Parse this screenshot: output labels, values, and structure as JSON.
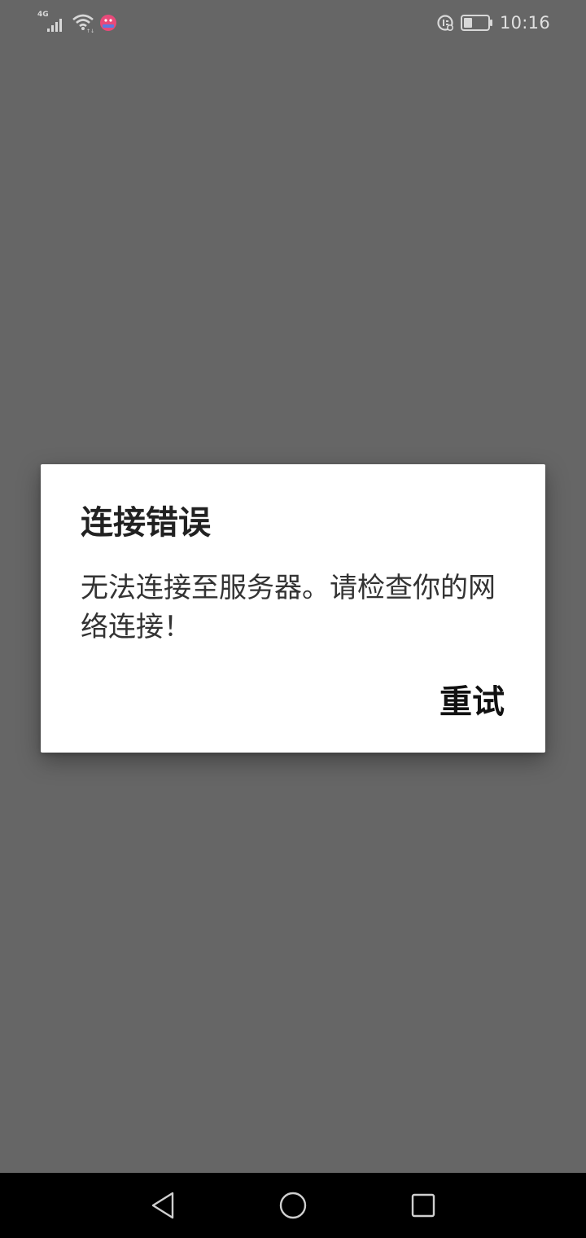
{
  "status_bar": {
    "network_type": "4G",
    "time": "10:16",
    "icons": [
      "signal-icon",
      "wifi-icon",
      "app-notification-icon",
      "data-saver-icon",
      "battery-icon"
    ],
    "battery_level": 0.35
  },
  "dialog": {
    "title": "连接错误",
    "message": "无法连接至服务器。请检查你的网络连接！",
    "retry_label": "重试"
  },
  "nav_bar": {
    "icons": [
      "back-icon",
      "home-icon",
      "recent-apps-icon"
    ]
  },
  "colors": {
    "scrim": "#666666",
    "dialog_bg": "#ffffff",
    "nav_bar_bg": "#000000",
    "notification_badge": "#e84a7a"
  }
}
